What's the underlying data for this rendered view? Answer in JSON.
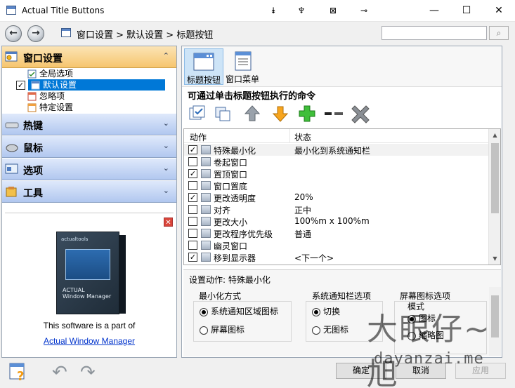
{
  "window": {
    "title": "Actual Title Buttons",
    "title_buttons": [
      "⯯",
      "♆",
      "⊠",
      "⊸"
    ],
    "minimize": "—",
    "maximize": "☐",
    "close": "✕"
  },
  "nav": {
    "back": "←",
    "forward": "→",
    "breadcrumb": "窗口设置 > 默认设置 > 标题按钮",
    "search_value": "",
    "search_button": "⌕"
  },
  "sidebar": {
    "sections": [
      {
        "label": "窗口设置",
        "expanded": true,
        "chevron": "⌃"
      },
      {
        "label": "热键",
        "expanded": false,
        "chevron": "⌄"
      },
      {
        "label": "鼠标",
        "expanded": false,
        "chevron": "⌄"
      },
      {
        "label": "选项",
        "expanded": false,
        "chevron": "⌄"
      },
      {
        "label": "工具",
        "expanded": false,
        "chevron": "⌄"
      }
    ],
    "tree": [
      {
        "label": "全局选项",
        "checkbox": false,
        "selected": false
      },
      {
        "label": "默认设置",
        "checkbox": true,
        "checked": true,
        "selected": true
      },
      {
        "label": "忽略项",
        "checkbox": false,
        "selected": false
      },
      {
        "label": "特定设置",
        "checkbox": false,
        "selected": false
      }
    ],
    "ad": {
      "close": "✕",
      "box_brand": "actualtools",
      "box_product_line1": "ACTUAL",
      "box_product_line2": "Window Manager",
      "text": "This software is a part of",
      "link": "Actual Window Manager"
    }
  },
  "main": {
    "tabs": [
      {
        "label": "标题按钮",
        "active": true
      },
      {
        "label": "窗口菜单",
        "active": false
      }
    ],
    "section_title": "可通过单击标题按钮执行的命令",
    "toolbar_icons": [
      "check-all-icon",
      "copy-icon",
      "move-up-icon",
      "move-down-icon",
      "add-icon",
      "separator-icon",
      "delete-icon"
    ],
    "list": {
      "columns": [
        "动作",
        "状态"
      ],
      "rows": [
        {
          "name": "特殊最小化",
          "state": "最小化到系统通知栏",
          "checked": true,
          "highlight": true
        },
        {
          "name": "卷起窗口",
          "state": "",
          "checked": false
        },
        {
          "name": "置顶窗口",
          "state": "",
          "checked": true
        },
        {
          "name": "窗口置底",
          "state": "",
          "checked": false
        },
        {
          "name": "更改透明度",
          "state": "20%",
          "checked": true
        },
        {
          "name": "对齐",
          "state": "正中",
          "checked": false
        },
        {
          "name": "更改大小",
          "state": "100%m x 100%m",
          "checked": false
        },
        {
          "name": "更改程序优先级",
          "state": "普通",
          "checked": false
        },
        {
          "name": "幽灵窗口",
          "state": "",
          "checked": false
        },
        {
          "name": "移到显示器",
          "state": "<下一个>",
          "checked": true
        }
      ]
    },
    "settings": {
      "title": "设置动作: 特殊最小化",
      "groups": [
        {
          "label": "最小化方式",
          "options": [
            {
              "label": "系统通知区域图标",
              "on": true
            },
            {
              "label": "屏幕图标",
              "on": false
            }
          ]
        },
        {
          "label": "系统通知栏选项",
          "options": [
            {
              "label": "切换",
              "on": true
            },
            {
              "label": "无图标",
              "on": false
            }
          ]
        },
        {
          "label": "屏幕图标选项",
          "sub": "模式",
          "options": [
            {
              "label": "图标",
              "on": true
            },
            {
              "label": "缩略图",
              "on": false
            }
          ]
        }
      ]
    }
  },
  "bottom": {
    "ok": "确定",
    "cancel": "取消",
    "apply": "应用"
  },
  "watermark": {
    "big": "大眼仔~旭",
    "small": "dayanzai.me"
  },
  "colors": {
    "selection": "#0078d7",
    "section_open": "#f6c56e",
    "section_closed": "#b1c7ef"
  }
}
